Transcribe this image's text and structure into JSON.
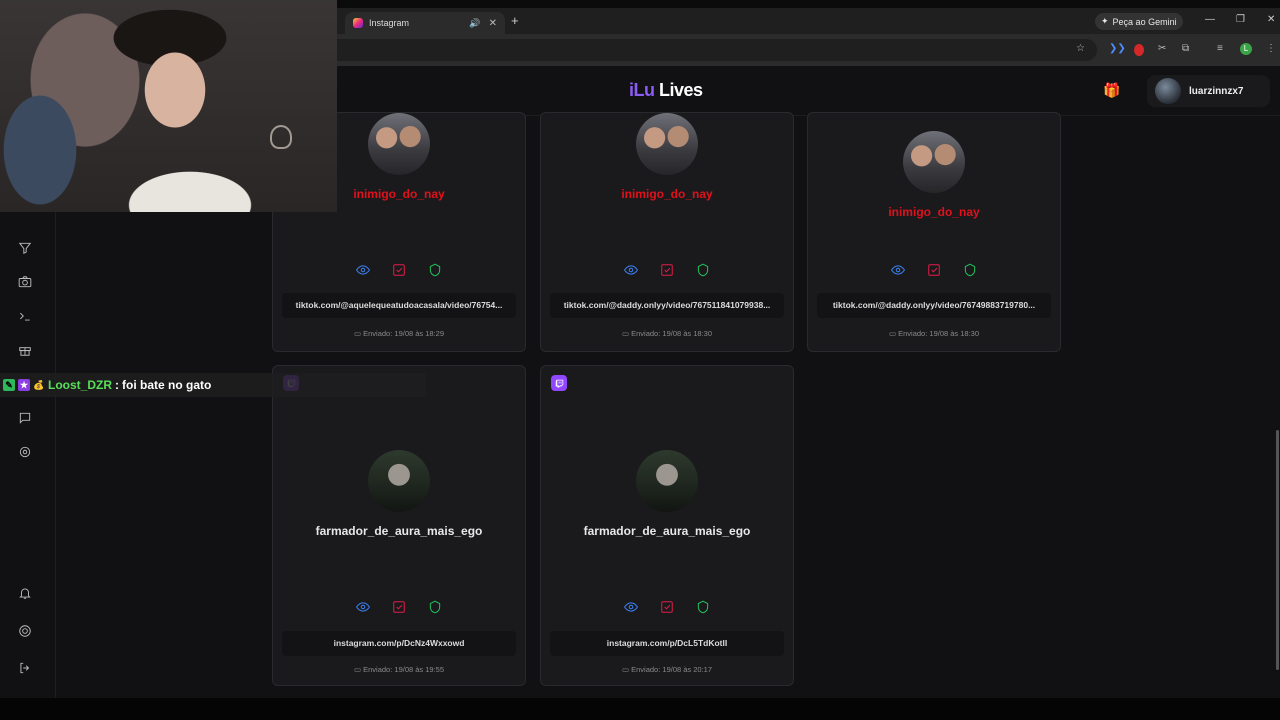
{
  "browser": {
    "tab_title": "Instagram",
    "tab_audio_icon": "speaker-icon",
    "gemini_label": "Peça ao Gemini"
  },
  "app": {
    "logo_part1": "iLu",
    "logo_part2": "Lives",
    "username": "luarzinnzx7",
    "colors": {
      "accent": "#8b5cf6",
      "danger": "#e0111b",
      "eye": "#3b82f6",
      "check": "#e11d48",
      "shield": "#22c55e",
      "twitch": "#9146ff"
    }
  },
  "cards": [
    {
      "username": "inimigo_do_nay",
      "name_color": "red",
      "url": "tiktok.com/@aquelequeatudoacasala/video/76754...",
      "sent": "Enviado: 19/08 às 18:29"
    },
    {
      "username": "inimigo_do_nay",
      "name_color": "red",
      "url": "tiktok.com/@daddy.onlyy/video/767511841079938...",
      "sent": "Enviado: 19/08 às 18:30"
    },
    {
      "username": "inimigo_do_nay",
      "name_color": "red",
      "url": "tiktok.com/@daddy.onlyy/video/76749883719780...",
      "sent": "Enviado: 19/08 às 18:30"
    },
    {
      "username": "farmador_de_aura_mais_ego",
      "name_color": "white",
      "url": "instagram.com/p/DcNz4Wxxowd",
      "sent": "Enviado: 19/08 às 19:55",
      "platform_icon": "twitch-icon"
    },
    {
      "username": "farmador_de_aura_mais_ego",
      "name_color": "white",
      "url": "instagram.com/p/DcL5TdKotlI",
      "sent": "Enviado: 19/08 às 20:17",
      "platform_icon": "twitch-icon"
    }
  ],
  "sidebar": {
    "icons": [
      "filter-icon",
      "camera-icon",
      "terminal-icon",
      "gift-icon",
      "chat-icon",
      "settings-icon",
      "bell-icon",
      "help-icon",
      "logout-icon"
    ]
  },
  "chat_overlay": {
    "author": "Loost_DZR",
    "separator": ":",
    "message": "foi bate no gato"
  }
}
